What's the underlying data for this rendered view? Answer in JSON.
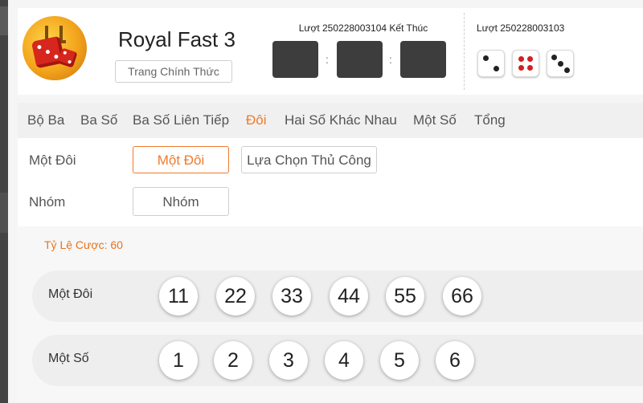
{
  "header": {
    "game_title": "Royal Fast 3",
    "official_button": "Trang Chính Thức",
    "current_round": "Lượt 250228003104 Kết Thúc",
    "previous_round": "Lượt 250228003103",
    "colon": ":",
    "previous_dice": [
      2,
      4,
      3
    ]
  },
  "tabs": [
    {
      "label": "Bộ Ba"
    },
    {
      "label": "Ba Số"
    },
    {
      "label": "Ba Số Liên Tiếp"
    },
    {
      "label": "Đôi",
      "active": true
    },
    {
      "label": "Hai Số Khác Nhau"
    },
    {
      "label": "Một Số"
    },
    {
      "label": "Tổng"
    }
  ],
  "options": {
    "row1_label": "Một Đôi",
    "row1_buttons": [
      "Một Đôi",
      "Lựa Chọn Thủ Công"
    ],
    "row2_label": "Nhóm",
    "row2_buttons": [
      "Nhóm"
    ]
  },
  "betting": {
    "rate": "Tỷ Lệ Cược: 60",
    "rows": [
      {
        "label": "Một Đôi",
        "balls": [
          "11",
          "22",
          "33",
          "44",
          "55",
          "66"
        ]
      },
      {
        "label": "Một Số",
        "balls": [
          "1",
          "2",
          "3",
          "4",
          "5",
          "6"
        ]
      }
    ]
  },
  "colors": {
    "accent": "#f07a2a",
    "slot": "#3d3d3d",
    "red_pip": "#d32020"
  }
}
